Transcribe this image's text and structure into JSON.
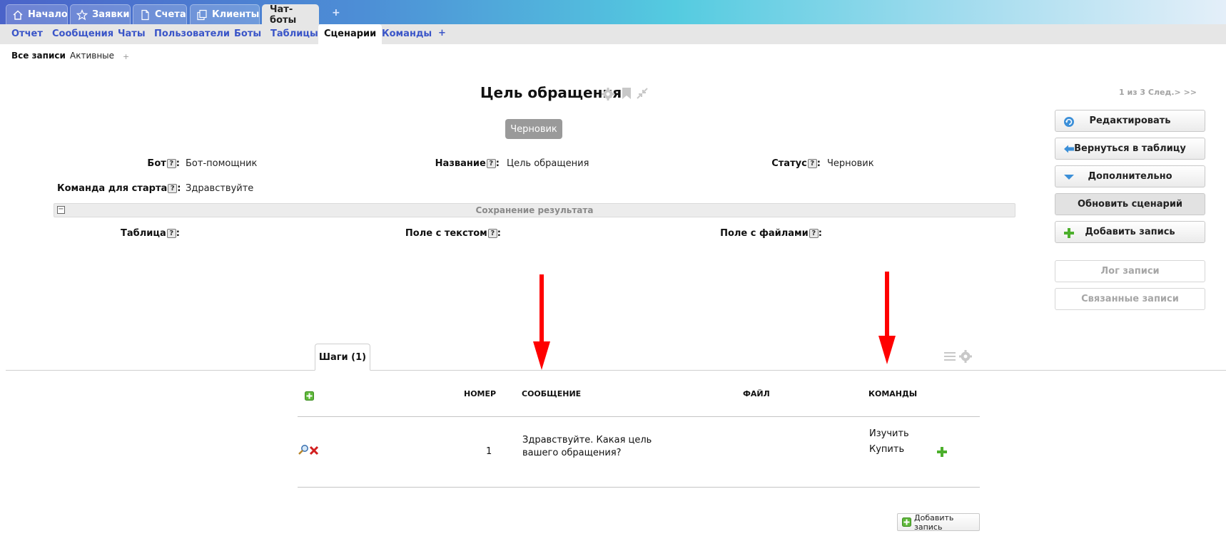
{
  "top_tabs": [
    {
      "label": "Начало",
      "icon": "home-icon"
    },
    {
      "label": "Заявки",
      "icon": "star-icon"
    },
    {
      "label": "Счета",
      "icon": "document-icon"
    },
    {
      "label": "Клиенты",
      "icon": "copy-icon"
    },
    {
      "label": "Чат-боты",
      "icon": "",
      "active": true
    }
  ],
  "top_tabs_add": "+",
  "sub_tabs": [
    {
      "label": "Отчет"
    },
    {
      "label": "Сообщения"
    },
    {
      "label": "Чаты"
    },
    {
      "label": "Пользователи"
    },
    {
      "label": "Боты"
    },
    {
      "label": "Таблицы"
    },
    {
      "label": "Сценарии",
      "active": true
    },
    {
      "label": "Команды"
    }
  ],
  "sub_tabs_add": "+",
  "filters": {
    "all": "Все записи",
    "active": "Активные",
    "add": "+"
  },
  "record": {
    "title": "Цель обращения",
    "status_badge": "Черновик",
    "pager": "1 из 3 След.> >>",
    "fields": {
      "bot_label": "Бот",
      "bot_value": "Бот-помощник",
      "name_label": "Название",
      "name_value": "Цель обращения",
      "status_label": "Статус",
      "status_value": "Черновик",
      "start_cmd_label": "Команда для старта",
      "start_cmd_value": "Здравствуйте"
    },
    "help_mark": "?",
    "colon": ":",
    "section": {
      "collapse": "−",
      "title": "Сохранение результата",
      "table_label": "Таблица",
      "text_field_label": "Поле с текстом",
      "files_field_label": "Поле с файлами"
    }
  },
  "actions": {
    "edit": "Редактировать",
    "back": "Вернуться в таблицу",
    "more": "Дополнительно",
    "update": "Обновить сценарий",
    "add": "Добавить запись",
    "log": "Лог записи",
    "related": "Связанные записи"
  },
  "steps": {
    "tab_label": "Шаги (1)",
    "columns": {
      "number": "НОМЕР",
      "message": "СООБЩЕНИЕ",
      "file": "ФАЙЛ",
      "commands": "КОМАНДЫ"
    },
    "rows": [
      {
        "number": "1",
        "message": "Здравствуйте. Какая цель вашего обращения?",
        "file": "",
        "commands": [
          "Изучить",
          "Купить"
        ]
      }
    ],
    "add_record": "Добавить запись"
  },
  "colors": {
    "accent_blue": "#3a55c8",
    "arrow_red": "#ff0000",
    "add_green": "#4caf2c"
  }
}
